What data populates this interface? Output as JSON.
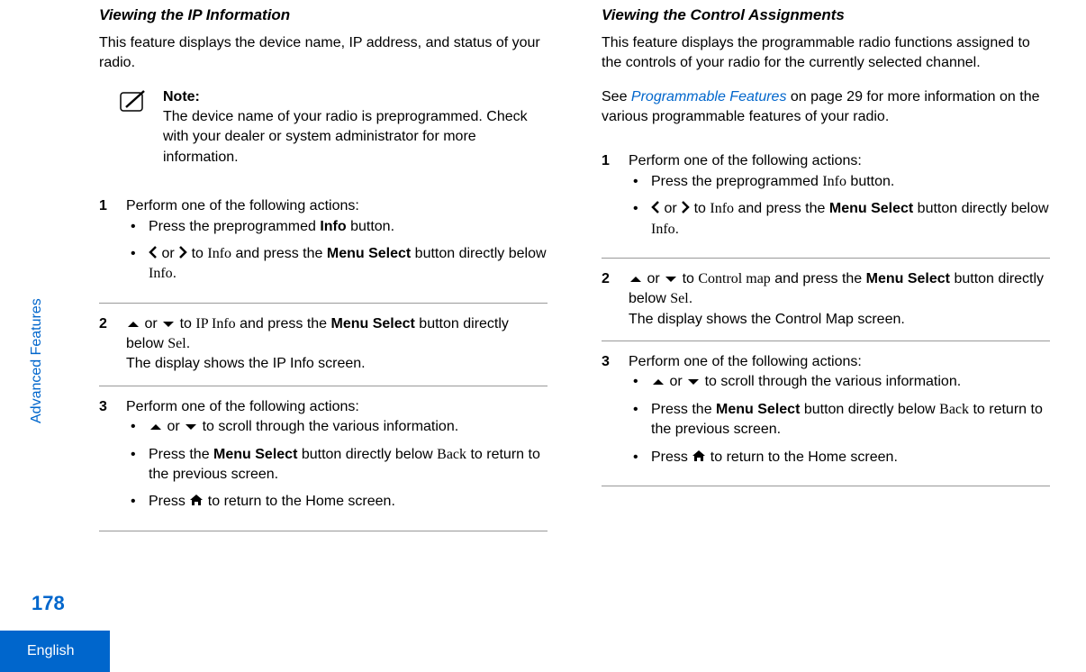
{
  "sidebar": {
    "vertical_label": "Advanced Features",
    "page_number": "178",
    "language": "English"
  },
  "left": {
    "title": "Viewing the IP Information",
    "intro": "This feature displays the device name, IP address, and status of your radio.",
    "note_label": "Note:",
    "note_text": "The device name of your radio is preprogrammed. Check with your dealer or system administrator for more information.",
    "step1": {
      "num": "1",
      "text": "Perform one of the following actions:",
      "b1_pre": "Press the preprogrammed ",
      "b1_bold": "Info",
      "b1_post": " button.",
      "b2_mid": " to ",
      "b2_info": "Info",
      "b2_mid2": " and press the ",
      "b2_bold": "Menu Select",
      "b2_post": " button directly below ",
      "b2_info2": "Info",
      "b2_end": "."
    },
    "step2": {
      "num": "2",
      "mid": " to ",
      "ipinfo": "IP Info",
      "mid2": " and press the ",
      "bold": "Menu Select",
      "post": " button directly below ",
      "sel": "Sel",
      "end": ".",
      "result": "The display shows the IP Info screen."
    },
    "step3": {
      "num": "3",
      "text": "Perform one of the following actions:",
      "b1": " to scroll through the various information.",
      "b2_pre": "Press the ",
      "b2_bold": "Menu Select",
      "b2_mid": " button directly below ",
      "b2_back": "Back",
      "b2_post": " to return to the previous screen.",
      "b3_pre": "Press ",
      "b3_post": " to return to the Home screen."
    }
  },
  "right": {
    "title": "Viewing the Control Assignments",
    "intro": "This feature displays the programmable radio functions assigned to the controls of your radio for the currently selected channel.",
    "see_pre": "See ",
    "see_link": "Programmable Features",
    "see_post": " on page 29 for more information on the various programmable features of your radio.",
    "step1": {
      "num": "1",
      "text": "Perform one of the following actions:",
      "b1_pre": "Press the preprogrammed ",
      "b1_info": "Info",
      "b1_post": " button.",
      "b2_mid": " to ",
      "b2_info": "Info",
      "b2_mid2": " and press the ",
      "b2_bold": "Menu Select",
      "b2_post": " button directly below ",
      "b2_info2": "Info",
      "b2_end": "."
    },
    "step2": {
      "num": "2",
      "mid": " to ",
      "cmap": "Control map",
      "mid2": " and press the ",
      "bold": "Menu Select",
      "post": " button directly below ",
      "sel": "Sel",
      "end": ".",
      "result": "The display shows the Control Map screen."
    },
    "step3": {
      "num": "3",
      "text": "Perform one of the following actions:",
      "b1": " to scroll through the various information.",
      "b2_pre": "Press the ",
      "b2_bold": "Menu Select",
      "b2_mid": " button directly below ",
      "b2_back": "Back",
      "b2_post": " to return to the previous screen.",
      "b3_pre": "Press ",
      "b3_post": " to return to the Home screen."
    }
  },
  "or_text": " or "
}
